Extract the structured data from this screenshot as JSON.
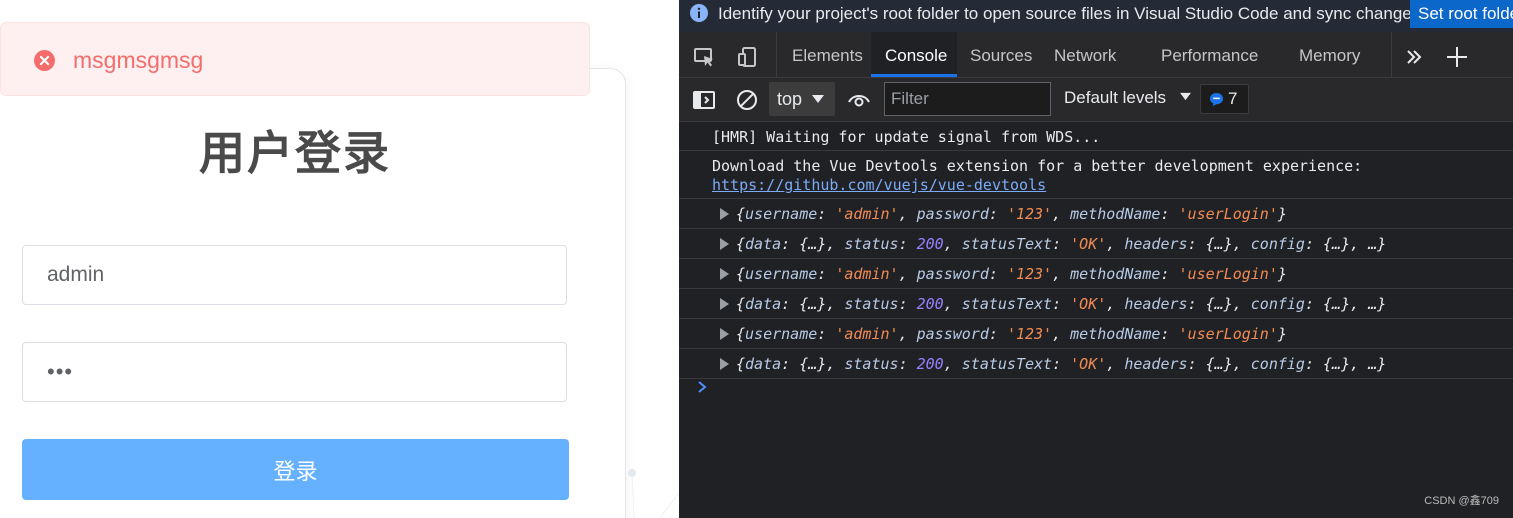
{
  "app": {
    "alert": {
      "text": "msgmsgmsg"
    },
    "title": "用户登录",
    "username": {
      "value": "admin"
    },
    "password": {
      "value": "•••"
    },
    "login_button": "登录"
  },
  "devtools": {
    "infobar": {
      "text": "Identify your project's root folder to open source files in Visual Studio Code and sync changes.",
      "button": "Set root folde"
    },
    "tabs": [
      "Elements",
      "Console",
      "Sources",
      "Network",
      "Performance",
      "Memory"
    ],
    "active_tab": "Console",
    "toolbar": {
      "context": "top",
      "filter_placeholder": "Filter",
      "levels": "Default levels",
      "issues_count": "7"
    },
    "console": {
      "hmr": "[HMR] Waiting for update signal from WDS...",
      "vue_msg": "Download the Vue Devtools extension for a better development experience:",
      "vue_link": "https://github.com/vuejs/vue-devtools",
      "obj_a": {
        "k1": "username",
        "v1": "'admin'",
        "k2": "password",
        "v2": "'123'",
        "k3": "methodName",
        "v3": "'userLogin'"
      },
      "obj_b": {
        "k1": "data",
        "v1": "{…}",
        "k2": "status",
        "v2": "200",
        "k3": "statusText",
        "v3": "'OK'",
        "k4": "headers",
        "v4": "{…}",
        "k5": "config",
        "v5": "{…}",
        "more": "…"
      }
    },
    "watermark": "CSDN @鑫709"
  },
  "colors": {
    "alert_text": "#f56c6c",
    "alert_bg": "#fef0f0",
    "login_button": "#66b1ff",
    "devtools_bg": "#202124",
    "active_tab_underline": "#1a73e8",
    "string": "#f28b54",
    "number": "#9980ff"
  }
}
